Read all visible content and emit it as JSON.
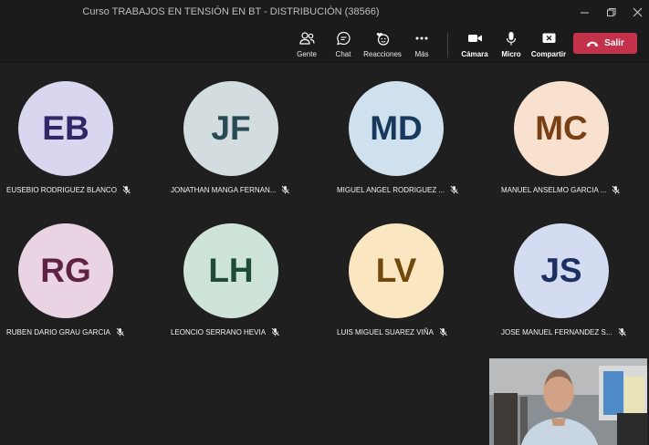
{
  "window": {
    "title": "Curso TRABAJOS EN TENSIÓN EN BT - DISTRIBUCIÓN (38566)",
    "minimize_icon": "minimize-icon",
    "maximize_icon": "restore-icon",
    "close_icon": "close-icon"
  },
  "toolbar": {
    "people": {
      "label": "Gente",
      "icon": "people-icon"
    },
    "chat": {
      "label": "Chat",
      "icon": "chat-icon"
    },
    "reactions": {
      "label": "Reacciones",
      "icon": "reactions-icon"
    },
    "more": {
      "label": "Más",
      "icon": "more-icon"
    },
    "camera": {
      "label": "Cámara",
      "icon": "camera-icon"
    },
    "mic": {
      "label": "Micro",
      "icon": "microphone-icon"
    },
    "share": {
      "label": "Compartir",
      "icon": "share-icon"
    },
    "leave": {
      "label": "Salir",
      "icon": "hangup-icon",
      "color": "#c4314b"
    }
  },
  "participants": [
    {
      "initials": "EB",
      "name": "EUSEBIO RODRIGUEZ BLANCO",
      "bg": "#d9d7ef",
      "fg": "#2f2868",
      "muted": true
    },
    {
      "initials": "JF",
      "name": "JONATHAN MANGA FERNAN...",
      "bg": "#d3dde0",
      "fg": "#274a53",
      "muted": true
    },
    {
      "initials": "MD",
      "name": "MIGUEL ANGEL RODRIGUEZ ...",
      "bg": "#cfe1ef",
      "fg": "#17395b",
      "muted": true
    },
    {
      "initials": "MC",
      "name": "MANUEL ANSELMO GARCIA ...",
      "bg": "#f8e2cf",
      "fg": "#7a4015",
      "muted": true
    },
    {
      "initials": "RG",
      "name": "RUBEN DARIO GRAU GARCIA",
      "bg": "#ead4e3",
      "fg": "#5e2245",
      "muted": true
    },
    {
      "initials": "LH",
      "name": "LEONCIO SERRANO HEVIA",
      "bg": "#cfe4d8",
      "fg": "#1f4a35",
      "muted": true
    },
    {
      "initials": "LV",
      "name": "LUIS MIGUEL SUAREZ VIÑA",
      "bg": "#fbe6c2",
      "fg": "#714a0b",
      "muted": true
    },
    {
      "initials": "JS",
      "name": "JOSE MANUEL FERNANDEZ S...",
      "bg": "#d3dcf0",
      "fg": "#1e2f63",
      "muted": true
    }
  ],
  "self_view": {
    "icon": "self-video-icon"
  }
}
